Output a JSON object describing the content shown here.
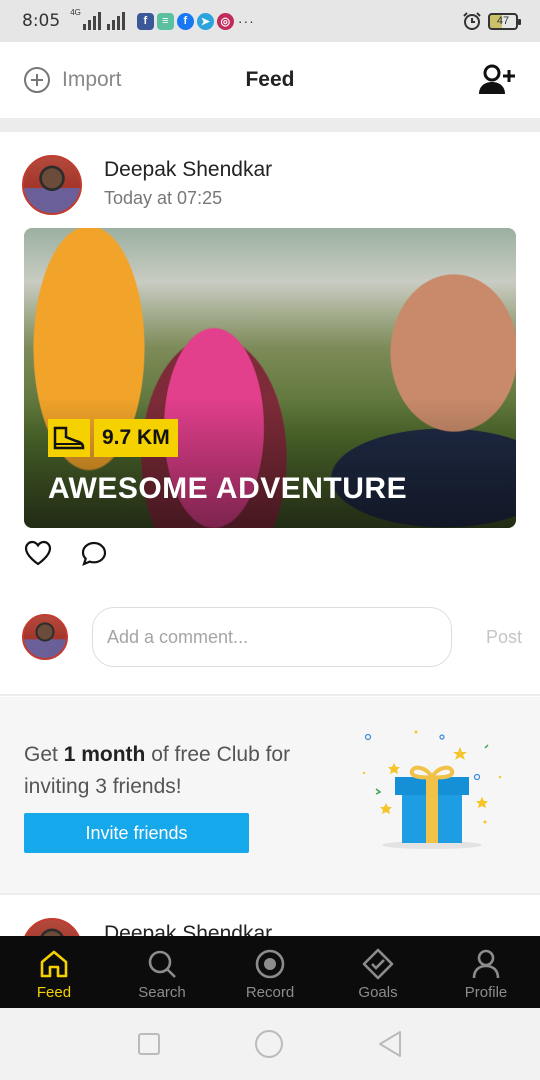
{
  "status_bar": {
    "time": "8:05",
    "network_label": "4G",
    "battery": "47",
    "more": "···"
  },
  "header": {
    "import_label": "Import",
    "title": "Feed"
  },
  "post": {
    "author": "Deepak Shendkar",
    "time": "Today at 07:25",
    "distance": "9.7 KM",
    "activity_title": "AWESOME ADVENTURE",
    "comment_placeholder": "Add a comment...",
    "post_label": "Post"
  },
  "invite": {
    "text_before": "Get ",
    "text_bold": "1 month",
    "text_after": " of free Club for inviting 3 friends!",
    "button_label": "Invite friends"
  },
  "next_post": {
    "author": "Deepak Shendkar"
  },
  "bottom_nav": {
    "feed": "Feed",
    "search": "Search",
    "record": "Record",
    "goals": "Goals",
    "profile": "Profile"
  },
  "colors": {
    "accent_yellow": "#f5d100",
    "invite_blue": "#15a8eb",
    "nav_background": "#0c0c0c"
  }
}
